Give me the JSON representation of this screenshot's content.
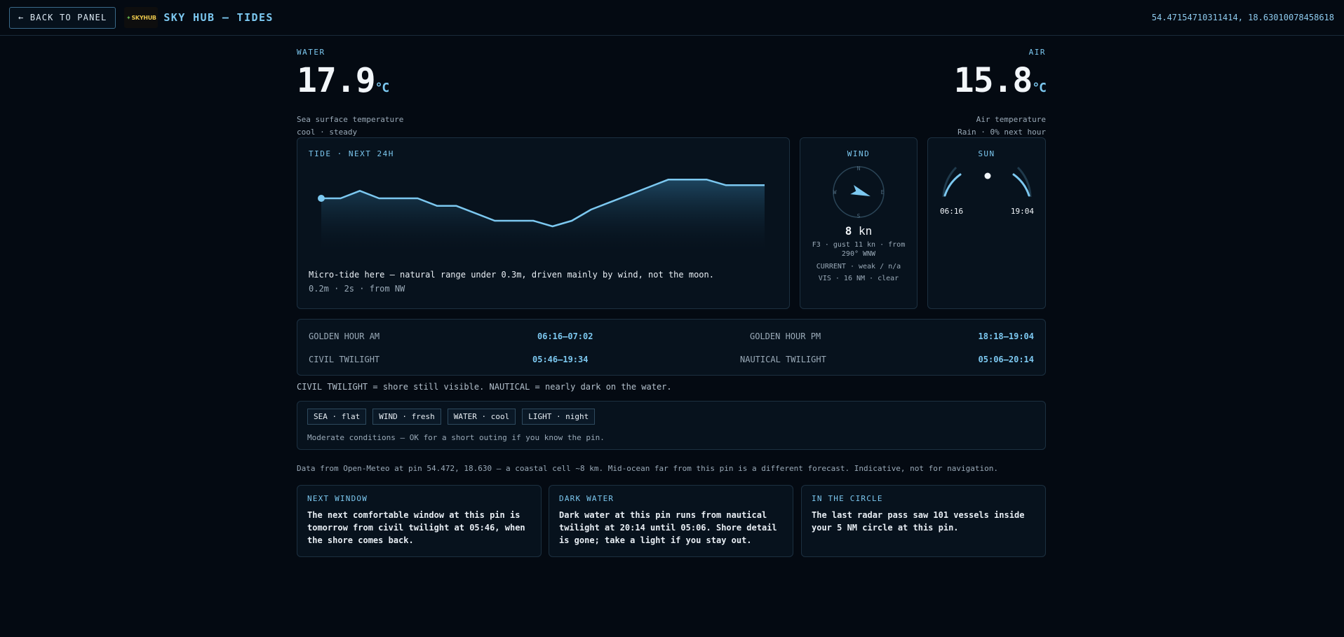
{
  "header": {
    "back_label": "← BACK TO PANEL",
    "logo_text": "SKYHUB",
    "title": "SKY HUB — TIDES",
    "coordinates": "54.47154710311414, 18.63010078458618"
  },
  "water": {
    "label": "WATER",
    "value": "17.9",
    "unit": "°C",
    "desc1": "Sea surface temperature",
    "desc2": "cool · steady"
  },
  "air": {
    "label": "AIR",
    "value": "15.8",
    "unit": "°C",
    "desc1": "Air temperature",
    "desc2": "Rain · 0% next hour"
  },
  "tide": {
    "label": "TIDE · NEXT 24H",
    "note": "Micro-tide here — natural range under 0.3m, driven mainly by wind, not the moon.",
    "sub": "0.2m · 2s · from NW",
    "chart_data": {
      "type": "area",
      "values": [
        0.62,
        0.62,
        0.66,
        0.62,
        0.62,
        0.62,
        0.58,
        0.58,
        0.54,
        0.5,
        0.5,
        0.5,
        0.47,
        0.5,
        0.56,
        0.6,
        0.64,
        0.68,
        0.72,
        0.72,
        0.72,
        0.69,
        0.69,
        0.69
      ],
      "ylim": [
        0.35,
        0.8
      ],
      "color": "#7cc8f0"
    }
  },
  "wind": {
    "label": "WIND",
    "compass": {
      "n": "N",
      "e": "E",
      "s": "S",
      "w": "W"
    },
    "speed": "8",
    "unit": "kn",
    "detail": "F3 · gust 11 kn · from 290° WNW",
    "current": "CURRENT · weak / n/a",
    "visibility": "VIS · 16 NM · clear",
    "direction_deg": 290
  },
  "sun": {
    "label": "SUN",
    "sunrise": "06:16",
    "sunset": "19:04"
  },
  "light": {
    "golden_am_label": "GOLDEN HOUR AM",
    "golden_am": "06:16–07:02",
    "golden_pm_label": "GOLDEN HOUR PM",
    "golden_pm": "18:18–19:04",
    "civil_label": "CIVIL TWILIGHT",
    "civil": "05:46–19:34",
    "nautical_label": "NAUTICAL TWILIGHT",
    "nautical": "05:06–20:14"
  },
  "twilight_note": "CIVIL TWILIGHT = shore still visible. NAUTICAL = nearly dark on the water.",
  "conditions": {
    "tags": [
      "SEA · flat",
      "WIND · fresh",
      "WATER · cool",
      "LIGHT · night"
    ],
    "summary": "Moderate conditions — OK for a short outing if you know the pin."
  },
  "source_note": "Data from Open-Meteo at pin 54.472, 18.630 — a coastal cell ~8 km. Mid-ocean far from this pin is a different forecast. Indicative, not for navigation.",
  "cards": [
    {
      "title": "NEXT WINDOW",
      "body": "The next comfortable window at this pin is tomorrow from civil twilight at 05:46, when the shore comes back."
    },
    {
      "title": "DARK WATER",
      "body": "Dark water at this pin runs from nautical twilight at 20:14 until 05:06. Shore detail is gone; take a light if you stay out."
    },
    {
      "title": "IN THE CIRCLE",
      "body": "The last radar pass saw 101 vessels inside your 5 NM circle at this pin."
    }
  ]
}
